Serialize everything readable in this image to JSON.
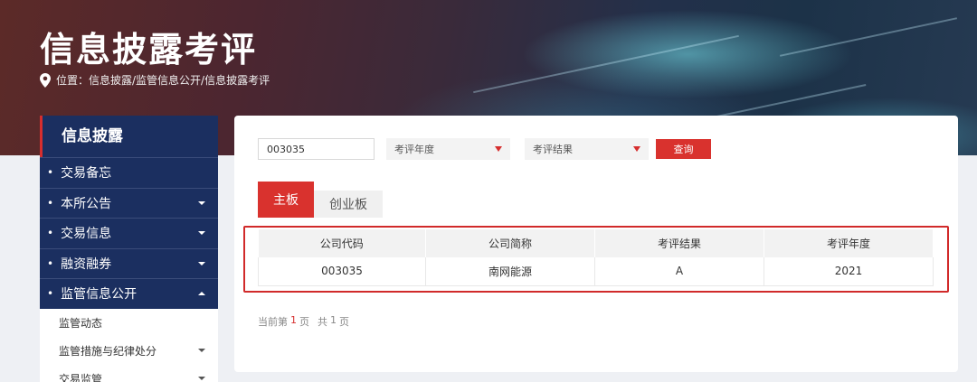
{
  "header": {
    "title": "信息披露考评",
    "breadcrumb": "位置：信息披露/监管信息公开/信息披露考评"
  },
  "sidebar": {
    "title": "信息披露",
    "main_items": [
      {
        "label": "交易备忘",
        "caret": "none"
      },
      {
        "label": "本所公告",
        "caret": "down"
      },
      {
        "label": "交易信息",
        "caret": "down"
      },
      {
        "label": "融资融券",
        "caret": "down"
      },
      {
        "label": "监管信息公开",
        "caret": "up"
      }
    ],
    "sub_items": [
      {
        "label": "监管动态",
        "caret": "none"
      },
      {
        "label": "监管措施与纪律处分",
        "caret": "down"
      },
      {
        "label": "交易监管",
        "caret": "down"
      }
    ]
  },
  "filters": {
    "code_value": "003035",
    "year_placeholder": "考评年度",
    "result_placeholder": "考评结果",
    "query_label": "查询"
  },
  "tabs": {
    "main_board": "主板",
    "chinext": "创业板"
  },
  "table": {
    "headers": [
      "公司代码",
      "公司简称",
      "考评结果",
      "考评年度"
    ],
    "rows": [
      [
        "003035",
        "南网能源",
        "A",
        "2021"
      ]
    ]
  },
  "pager": {
    "prefix": "当前第",
    "current": "1",
    "page_word": "页",
    "total_prefix": "共",
    "total": "1",
    "total_word": "页"
  },
  "colors": {
    "accent_red": "#d9322e",
    "nav_blue": "#1b2f60"
  }
}
